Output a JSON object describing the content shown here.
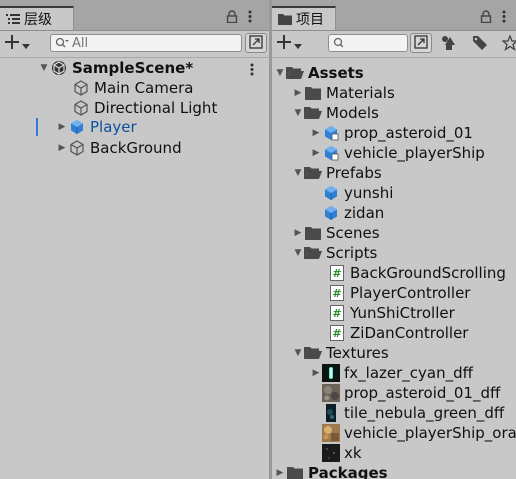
{
  "hierarchy": {
    "tab_title": "层级",
    "search_placeholder": "All",
    "scene_name": "SampleScene*",
    "items": [
      {
        "label": "Main Camera"
      },
      {
        "label": "Directional Light"
      },
      {
        "label": "Player"
      },
      {
        "label": "BackGround"
      }
    ]
  },
  "project": {
    "tab_title": "项目",
    "search_placeholder": "",
    "assets_label": "Assets",
    "folders": {
      "materials": "Materials",
      "models": "Models",
      "prefabs": "Prefabs",
      "scenes": "Scenes",
      "scripts": "Scripts",
      "textures": "Textures",
      "packages": "Packages"
    },
    "models": [
      "prop_asteroid_01",
      "vehicle_playerShip"
    ],
    "prefabs": [
      "yunshi",
      "zidan"
    ],
    "scripts": [
      "BackGroundScrolling",
      "PlayerController",
      "YunShiCtroller",
      "ZiDanController"
    ],
    "textures": [
      "fx_lazer_cyan_dff",
      "prop_asteroid_01_dff",
      "tile_nebula_green_dff",
      "vehicle_playerShip_ora",
      "xk"
    ]
  },
  "colors": {
    "panel_bg": "#c8c8c8",
    "tab_bar_bg": "#a5a5a5",
    "selected_text": "#0e4fa0",
    "prefab_blue": "#2f7fd4"
  }
}
